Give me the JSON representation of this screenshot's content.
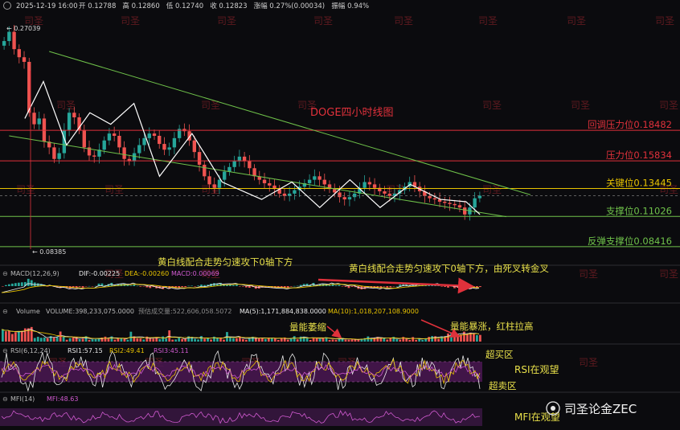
{
  "header": {
    "datetime": "2025-12-19 16:00",
    "items": [
      {
        "label": "开",
        "value": "0.12788"
      },
      {
        "label": "高",
        "value": "0.12860"
      },
      {
        "label": "低",
        "value": "0.12740"
      },
      {
        "label": "收",
        "value": "0.12823"
      },
      {
        "label": "涨幅",
        "value": "0.27%(0.00034)"
      },
      {
        "label": "振幅",
        "value": "0.94%"
      }
    ]
  },
  "watermark": "司圣",
  "brand": "司圣论金ZEC",
  "colors": {
    "up": "#26a69a",
    "down": "#ef5350",
    "resistance": "#e0313b",
    "key": "#e8c300",
    "support": "#6fc24a",
    "annotation": "#e8e04a",
    "title": "#e0313b",
    "rsi_band": "#5a1d63",
    "wave": "#ffffff"
  },
  "chart_data": [
    {
      "type": "candlestick",
      "title": "DOGE四小时线图",
      "ylim": [
        0.075,
        0.285
      ],
      "max_label": "0.27039",
      "min_label": "0.08385",
      "close": [
        0.262,
        0.27,
        0.255,
        0.248,
        0.244,
        0.2,
        0.19,
        0.195,
        0.175,
        0.17,
        0.16,
        0.165,
        0.185,
        0.2,
        0.196,
        0.185,
        0.17,
        0.163,
        0.162,
        0.168,
        0.176,
        0.182,
        0.18,
        0.17,
        0.16,
        0.158,
        0.165,
        0.172,
        0.178,
        0.182,
        0.18,
        0.173,
        0.168,
        0.17,
        0.178,
        0.186,
        0.184,
        0.176,
        0.166,
        0.155,
        0.145,
        0.138,
        0.135,
        0.142,
        0.149,
        0.153,
        0.158,
        0.162,
        0.158,
        0.152,
        0.145,
        0.142,
        0.139,
        0.137,
        0.134,
        0.13,
        0.128,
        0.13,
        0.133,
        0.136,
        0.139,
        0.142,
        0.145,
        0.142,
        0.138,
        0.134,
        0.131,
        0.127,
        0.125,
        0.127,
        0.13,
        0.135,
        0.14,
        0.138,
        0.135,
        0.132,
        0.13,
        0.128,
        0.13,
        0.133,
        0.136,
        0.14,
        0.136,
        0.132,
        0.128,
        0.126,
        0.125,
        0.123,
        0.122,
        0.121,
        0.12,
        0.118,
        0.112,
        0.118,
        0.126,
        0.1282
      ],
      "levels": [
        {
          "label": "回调压力位0.18482",
          "value": 0.18482,
          "kind": "resistance"
        },
        {
          "label": "压力位0.15834",
          "value": 0.15834,
          "kind": "resistance"
        },
        {
          "label": "关键位0.13445",
          "value": 0.13445,
          "kind": "key"
        },
        {
          "label": "支撑位0.11026",
          "value": 0.11026,
          "kind": "support"
        },
        {
          "label": "反弹支撑位0.08416",
          "value": 0.08416,
          "kind": "support"
        }
      ],
      "wave": [
        [
          10,
          0.195
        ],
        [
          18,
          0.227
        ],
        [
          28,
          0.172
        ],
        [
          38,
          0.2
        ],
        [
          47,
          0.19
        ],
        [
          57,
          0.208
        ],
        [
          68,
          0.145
        ],
        [
          82,
          0.182
        ],
        [
          95,
          0.14
        ],
        [
          112,
          0.125
        ],
        [
          125,
          0.14
        ],
        [
          137,
          0.118
        ],
        [
          150,
          0.142
        ],
        [
          163,
          0.118
        ],
        [
          176,
          0.138
        ],
        [
          189,
          0.125
        ],
        [
          200,
          0.123
        ],
        [
          206,
          0.112
        ]
      ]
    },
    {
      "type": "macd",
      "label": "MACD(12,26,9)",
      "dif_label": "DIF:-0.00225",
      "dea_label": "DEA:-0.00260",
      "macd_label": "MACD:0.00069"
    },
    {
      "type": "volume",
      "label": "Volume",
      "volume_label": "VOLUME:398,233,075.0000",
      "forecast_label": "预估成交量:522,606,058.5072",
      "ma5_label": "MA(5):1,171,884,838.0000",
      "ma10_label": "MA(10):1,018,207,108.9000"
    },
    {
      "type": "rsi",
      "label": "RSI(6,12,24)",
      "rsi1_label": "RSI1:57.15",
      "rsi2_label": "RSI2:49.41",
      "rsi3_label": "RSI3:45.11"
    },
    {
      "type": "mfi",
      "label": "MFI(14)",
      "mfi_label": "MFI:48.63"
    }
  ],
  "annotations": {
    "macd_left": "黄白线配合走势匀速攻下0轴下方",
    "macd_right": "黄白线配合走势匀速攻下0轴下方，由死叉转金叉",
    "vol_shrink": "量能萎缩",
    "vol_surge": "量能暴涨，红柱拉高",
    "overbought": "超买区",
    "rsi_watch": "RSI在观望",
    "oversold": "超卖区",
    "mfi_watch": "MFI在观望"
  }
}
